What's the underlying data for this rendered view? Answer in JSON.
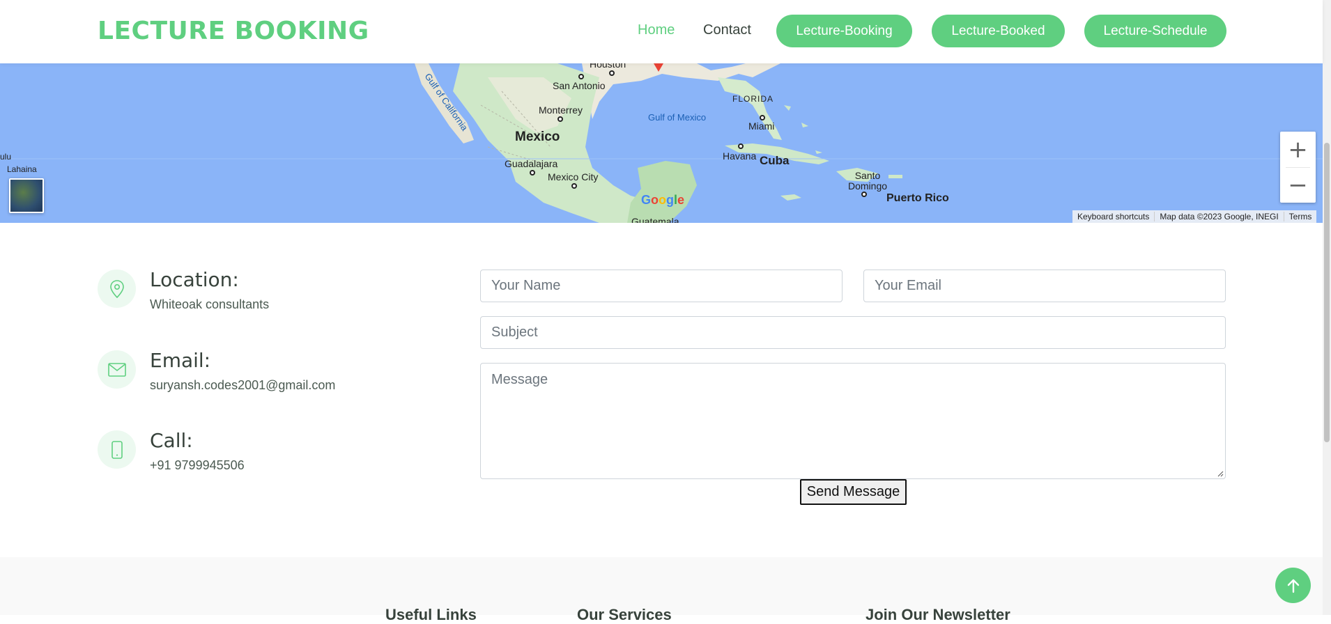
{
  "header": {
    "logo": "LECTURE BOOKING",
    "nav": [
      {
        "label": "Home"
      },
      {
        "label": "Contact"
      }
    ],
    "buttons": [
      {
        "label": "Lecture-Booking"
      },
      {
        "label": "Lecture-Booked"
      },
      {
        "label": "Lecture-Schedule"
      }
    ]
  },
  "map": {
    "labels": {
      "houston": "Houston",
      "san_antonio": "San Antonio",
      "monterrey": "Monterrey",
      "mexico": "Mexico",
      "guadalajara": "Guadalajara",
      "mexico_city": "Mexico City",
      "guatemala": "Guatemala",
      "gulf_of_california": "Gulf of California",
      "gulf_of_mexico": "Gulf of Mexico",
      "florida": "FLORIDA",
      "miami": "Miami",
      "havana": "Havana",
      "cuba": "Cuba",
      "santo_domingo": "Santo Domingo",
      "puerto_rico": "Puerto Rico",
      "lahaina": "Lahaina",
      "ulu": "ulu"
    },
    "attribution": {
      "shortcuts": "Keyboard shortcuts",
      "data": "Map data ©2023 Google, INEGI",
      "terms": "Terms"
    },
    "zoom_in": "+",
    "zoom_out": "−"
  },
  "contact": {
    "location": {
      "title": "Location:",
      "text": "Whiteoak consultants",
      "icon": "map-pin-icon"
    },
    "email": {
      "title": "Email:",
      "text": "suryansh.codes2001@gmail.com",
      "icon": "envelope-icon"
    },
    "call": {
      "title": "Call:",
      "text": "+91 9799945506",
      "icon": "phone-icon"
    }
  },
  "form": {
    "name_placeholder": "Your Name",
    "email_placeholder": "Your Email",
    "subject_placeholder": "Subject",
    "message_placeholder": "Message",
    "submit_label": "Send Message"
  },
  "footer": {
    "headings": [
      "Useful Links",
      "Our Services",
      "Join Our Newsletter"
    ]
  },
  "colors": {
    "accent": "#5fcf80",
    "text": "#37423b",
    "map_water": "#8ab4f8"
  }
}
